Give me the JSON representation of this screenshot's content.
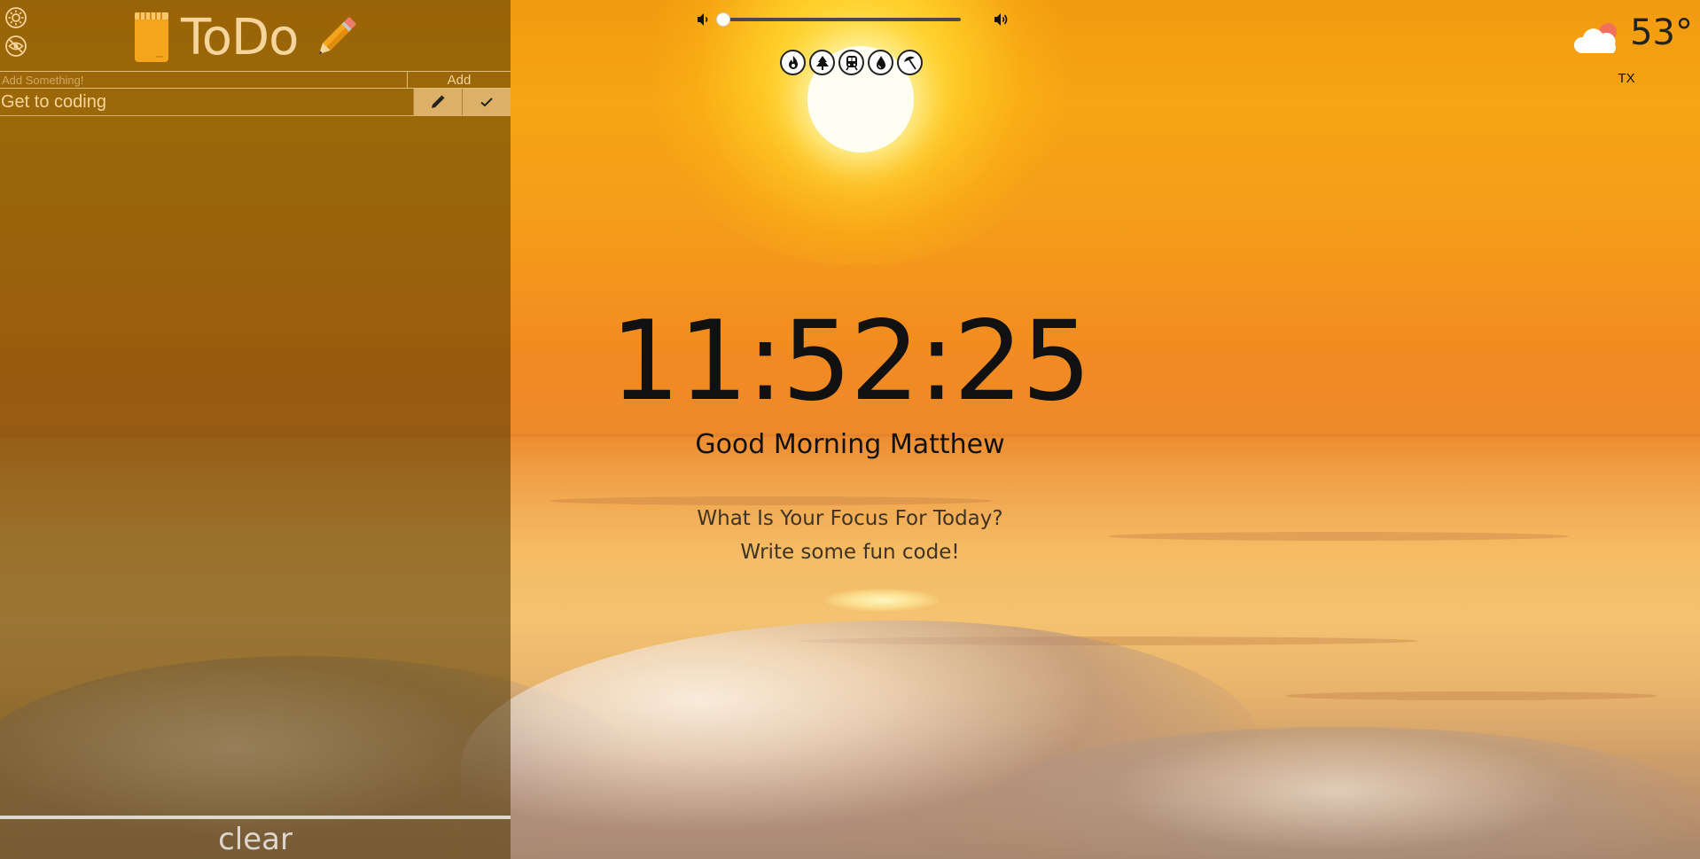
{
  "todo": {
    "title": "ToDo",
    "add_placeholder": "Add Something!",
    "add_label": "Add",
    "items": [
      {
        "text": "Get to coding"
      }
    ],
    "clear_label": "clear"
  },
  "audio": {
    "volume_level": 0.0
  },
  "sounds": [
    "fire-icon",
    "tree-icon",
    "train-icon",
    "water-drop-icon",
    "beach-umbrella-icon"
  ],
  "weather": {
    "temperature": "53°",
    "location": "TX",
    "condition_icon": "cloud-icon"
  },
  "clock": {
    "time": "11:52:25"
  },
  "greeting": {
    "text": "Good Morning Matthew"
  },
  "focus": {
    "question": "What Is Your Focus For Today?",
    "answer": "Write some fun code!"
  },
  "colors": {
    "panel_text": "#f6d59c",
    "sky_top": "#f29a10",
    "sky_mid": "#ee8a2a",
    "water": "#f4c271"
  }
}
